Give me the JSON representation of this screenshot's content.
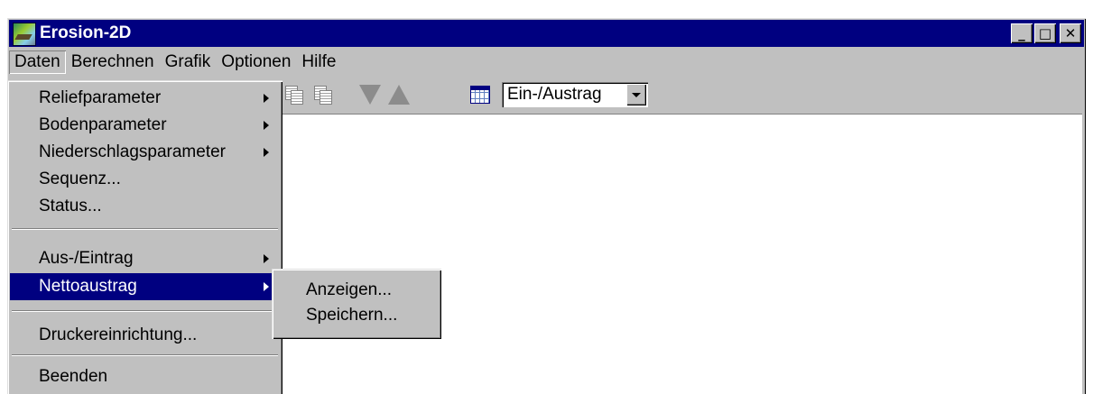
{
  "window": {
    "title": "Erosion-2D",
    "app_icon": "landscape-icon",
    "controls": [
      "minimize-icon",
      "maximize-icon",
      "close-icon"
    ]
  },
  "menubar": {
    "items": [
      {
        "label": "Daten"
      },
      {
        "label": "Berechnen"
      },
      {
        "label": "Grafik"
      },
      {
        "label": "Optionen"
      },
      {
        "label": "Hilfe"
      }
    ]
  },
  "toolbar": {
    "icons": [
      "copy-icon",
      "copy-icon",
      "arrow-down-icon",
      "arrow-up-icon",
      "calendar-icon"
    ],
    "combo_value": "Ein-/Austrag"
  },
  "daten_menu": {
    "items": [
      {
        "label": "Reliefparameter",
        "submenu": true
      },
      {
        "label": "Bodenparameter",
        "submenu": true
      },
      {
        "label": "Niederschlagsparameter",
        "submenu": true
      },
      {
        "label": "Sequenz..."
      },
      {
        "label": "Status..."
      },
      {
        "label": "Aus-/Eintrag",
        "submenu": true
      },
      {
        "label": "Nettoaustrag",
        "submenu": true,
        "highlighted": true
      },
      {
        "label": "Druckereinrichtung..."
      },
      {
        "label": "Beenden"
      }
    ]
  },
  "nettoaustrag_submenu": {
    "items": [
      {
        "label": "Anzeigen..."
      },
      {
        "label": "Speichern..."
      }
    ]
  },
  "colors": {
    "titlebar": "#000080",
    "face": "#c0c0c0",
    "highlight": "#000080"
  }
}
